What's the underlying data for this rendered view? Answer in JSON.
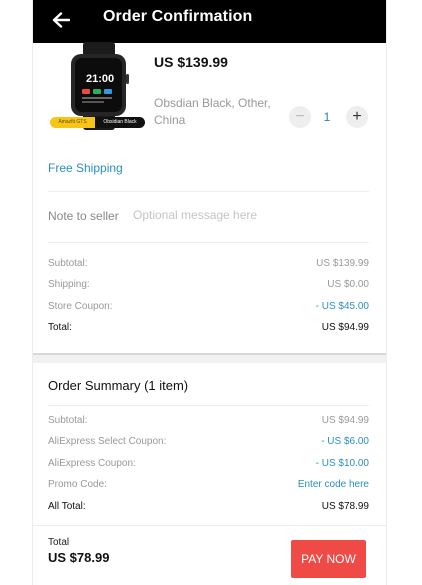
{
  "header": {
    "title": "Order Confirmation"
  },
  "product": {
    "price": "US $139.99",
    "variant": "Obsdian Black, Other, China",
    "quantity": "1",
    "tag_left": "Amazfit GTS",
    "tag_right": "Obsidian Black",
    "watch_time": "21:00"
  },
  "shipping": {
    "label": "Free Shipping"
  },
  "note": {
    "label": "Note to seller",
    "placeholder": "Optional message here"
  },
  "store_totals": {
    "subtotal_label": "Subtotal:",
    "subtotal_value": "US $139.99",
    "shipping_label": "Shipping:",
    "shipping_value": "US $0.00",
    "coupon_label": "Store Coupon:",
    "coupon_value": "- US $45.00",
    "total_label": "Total:",
    "total_value": "US $94.99"
  },
  "summary": {
    "title": "Order Summary (1 item)",
    "subtotal_label": "Subtotal:",
    "subtotal_value": "US $94.99",
    "select_coupon_label": "AliExpress Select Coupon:",
    "select_coupon_value": "- US $6.00",
    "ali_coupon_label": "AliExpress Coupon:",
    "ali_coupon_value": "- US $10.00",
    "promo_label": "Promo Code:",
    "promo_value": "Enter code here",
    "all_total_label": "All Total:",
    "all_total_value": "US $78.99"
  },
  "footer": {
    "total_label": "Total",
    "total_value": "US $78.99",
    "pay_label": "PAY NOW"
  },
  "colors": {
    "accent_blue": "#2a8fbe",
    "pay_red": "#f04a47",
    "appbar": "#000000"
  }
}
